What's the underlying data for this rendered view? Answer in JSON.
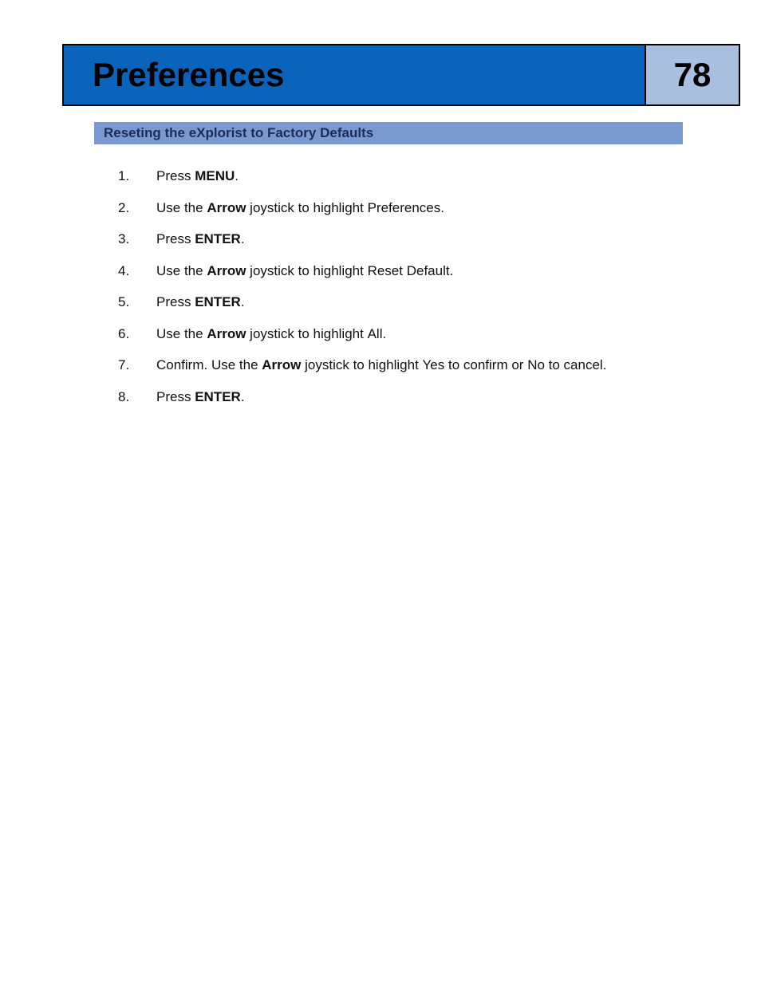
{
  "header": {
    "title": "Preferences",
    "page_number": "78"
  },
  "section": {
    "title": "Reseting the eXplorist to Factory Defaults"
  },
  "steps": [
    {
      "num": "1.",
      "parts": [
        {
          "t": "Press "
        },
        {
          "t": "MENU",
          "b": true
        },
        {
          "t": "."
        }
      ]
    },
    {
      "num": "2.",
      "parts": [
        {
          "t": "Use the "
        },
        {
          "t": "Arrow",
          "b": true
        },
        {
          "t": " joystick to highlight "
        },
        {
          "t": "Preferences",
          "mono": true
        },
        {
          "t": "."
        }
      ]
    },
    {
      "num": "3.",
      "parts": [
        {
          "t": "Press "
        },
        {
          "t": "ENTER",
          "b": true
        },
        {
          "t": "."
        }
      ]
    },
    {
      "num": "4.",
      "parts": [
        {
          "t": "Use the "
        },
        {
          "t": "Arrow",
          "b": true
        },
        {
          "t": " joystick to highlight "
        },
        {
          "t": "Reset Default",
          "mono": true
        },
        {
          "t": "."
        }
      ]
    },
    {
      "num": "5.",
      "parts": [
        {
          "t": "Press "
        },
        {
          "t": "ENTER",
          "b": true
        },
        {
          "t": "."
        }
      ]
    },
    {
      "num": "6.",
      "parts": [
        {
          "t": "Use the "
        },
        {
          "t": "Arrow",
          "b": true
        },
        {
          "t": " joystick to highlight "
        },
        {
          "t": "All",
          "mono": true
        },
        {
          "t": "."
        }
      ]
    },
    {
      "num": "7.",
      "parts": [
        {
          "t": "Confirm.  Use the "
        },
        {
          "t": "Arrow",
          "b": true
        },
        {
          "t": " joystick to highlight "
        },
        {
          "t": "Yes",
          "mono": true
        },
        {
          "t": " to confirm or "
        },
        {
          "t": "No",
          "mono": true
        },
        {
          "t": " to cancel."
        }
      ]
    },
    {
      "num": "8.",
      "parts": [
        {
          "t": "Press "
        },
        {
          "t": "ENTER",
          "b": true
        },
        {
          "t": "."
        }
      ]
    }
  ]
}
